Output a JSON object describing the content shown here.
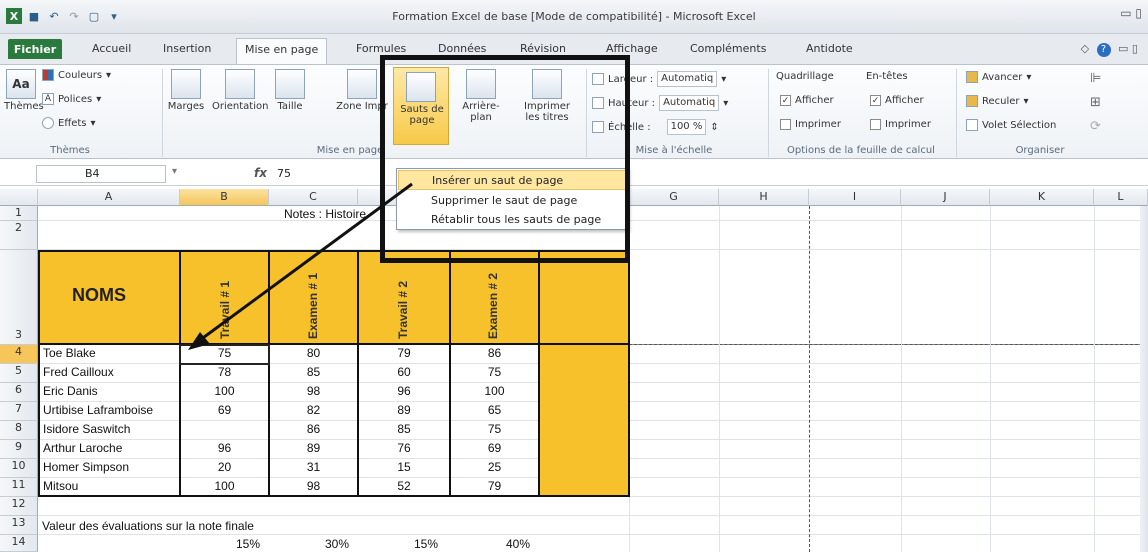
{
  "window": {
    "title": "Formation Excel de base [Mode de compatibilité] - Microsoft Excel"
  },
  "tabs": [
    "Fichier",
    "Accueil",
    "Insertion",
    "Mise en page",
    "Formules",
    "Données",
    "Révision",
    "Affichage",
    "Compléments",
    "Antidote"
  ],
  "active_tab": "Mise en page",
  "ribbon": {
    "themes": {
      "label": "Thèmes",
      "colors": "Couleurs",
      "fonts": "Polices",
      "effects": "Effets",
      "group": "Thèmes"
    },
    "page_setup": {
      "buttons": [
        "Marges",
        "Orientation",
        "Taille",
        "Zone Impr",
        "Sauts de page",
        "Arrière-plan",
        "Imprimer les titres"
      ],
      "group": "Mise en page"
    },
    "scale": {
      "width_label": "Largeur :",
      "width_value": "Automatiq",
      "height_label": "Hauteur :",
      "height_value": "Automatiq",
      "scale_label": "Échelle :",
      "scale_value": "100 %",
      "group": "Mise à l'échelle"
    },
    "sheet_options": {
      "gridlines": "Quadrillage",
      "headings": "En-têtes",
      "show": "Afficher",
      "print": "Imprimer",
      "group": "Options de la feuille de calcul"
    },
    "arrange": {
      "forward": "Avancer",
      "backward": "Reculer",
      "selection_pane": "Volet Sélection",
      "group": "Organiser"
    }
  },
  "menu": {
    "items": [
      "Insérer un saut de page",
      "Supprimer le saut de page",
      "Rétablir tous les sauts de page"
    ]
  },
  "formula_bar": {
    "cell_ref": "B4",
    "fx": "fx",
    "value": "75"
  },
  "columns": [
    "A",
    "B",
    "C",
    "D",
    "E",
    "F",
    "G",
    "H",
    "I",
    "J",
    "K",
    "L"
  ],
  "rows": [
    "1",
    "2",
    "3",
    "4",
    "5",
    "6",
    "7",
    "8",
    "9",
    "10",
    "11",
    "12",
    "13",
    "14"
  ],
  "sheet": {
    "c1_text": "Notes : Histoire",
    "noms_header": "NOMS",
    "eval_headers": [
      "Travail # 1",
      "Examen # 1",
      "Travail # 2",
      "Examen # 2"
    ],
    "students": [
      {
        "name": "Toe Blake",
        "values": [
          "75",
          "80",
          "79",
          "86"
        ]
      },
      {
        "name": "Fred Cailloux",
        "values": [
          "78",
          "85",
          "60",
          "75"
        ]
      },
      {
        "name": "Eric Danis",
        "values": [
          "100",
          "98",
          "96",
          "100"
        ]
      },
      {
        "name": "Urtibise Laframboise",
        "values": [
          "69",
          "82",
          "89",
          "65"
        ]
      },
      {
        "name": "Isidore Saswitch",
        "values": [
          "",
          "86",
          "85",
          "75"
        ]
      },
      {
        "name": "Arthur Laroche",
        "values": [
          "96",
          "89",
          "76",
          "69"
        ]
      },
      {
        "name": "Homer Simpson",
        "values": [
          "20",
          "31",
          "15",
          "25"
        ]
      },
      {
        "name": "Mitsou",
        "values": [
          "100",
          "98",
          "52",
          "79"
        ]
      }
    ],
    "row13_text": "Valeur des évaluations sur la note finale",
    "weights": [
      "15%",
      "30%",
      "15%",
      "40%"
    ]
  },
  "colors": {
    "accent": "#f7c12b",
    "file_tab": "#2b7a3d"
  }
}
